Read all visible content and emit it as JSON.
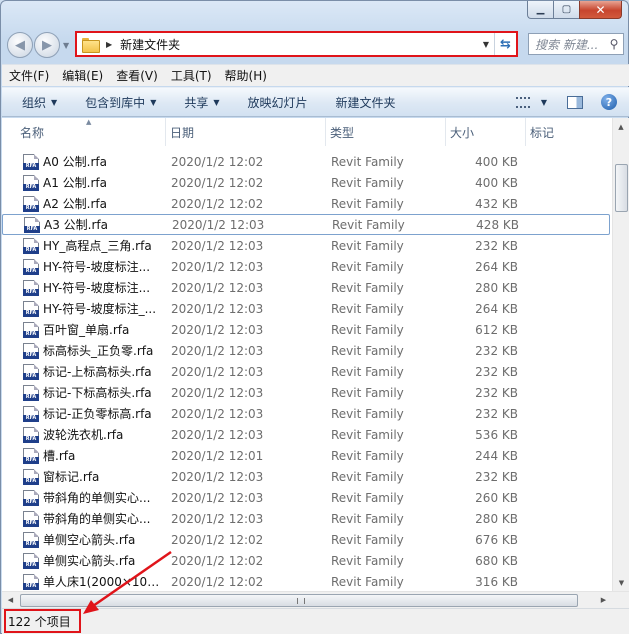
{
  "address": {
    "path": "新建文件夹"
  },
  "search": {
    "placeholder": "搜索 新建..."
  },
  "menu": [
    "文件(F)",
    "编辑(E)",
    "查看(V)",
    "工具(T)",
    "帮助(H)"
  ],
  "toolbar": {
    "organize": "组织",
    "include_library": "包含到库中",
    "share": "共享",
    "slideshow": "放映幻灯片",
    "new_folder": "新建文件夹"
  },
  "columns": {
    "name": "名称",
    "date": "日期",
    "type": "类型",
    "size": "大小",
    "tags": "标记"
  },
  "files": [
    {
      "name": "A0 公制.rfa",
      "date": "2020/1/2 12:02",
      "type": "Revit Family",
      "size": "400 KB"
    },
    {
      "name": "A1 公制.rfa",
      "date": "2020/1/2 12:02",
      "type": "Revit Family",
      "size": "400 KB"
    },
    {
      "name": "A2 公制.rfa",
      "date": "2020/1/2 12:02",
      "type": "Revit Family",
      "size": "432 KB"
    },
    {
      "name": "A3 公制.rfa",
      "date": "2020/1/2 12:03",
      "type": "Revit Family",
      "size": "428 KB",
      "selected": true
    },
    {
      "name": "HY_高程点_三角.rfa",
      "date": "2020/1/2 12:03",
      "type": "Revit Family",
      "size": "232 KB"
    },
    {
      "name": "HY-符号-坡度标注...",
      "date": "2020/1/2 12:03",
      "type": "Revit Family",
      "size": "264 KB"
    },
    {
      "name": "HY-符号-坡度标注...",
      "date": "2020/1/2 12:03",
      "type": "Revit Family",
      "size": "280 KB"
    },
    {
      "name": "HY-符号-坡度标注_...",
      "date": "2020/1/2 12:03",
      "type": "Revit Family",
      "size": "264 KB"
    },
    {
      "name": "百叶窗_单扇.rfa",
      "date": "2020/1/2 12:03",
      "type": "Revit Family",
      "size": "612 KB"
    },
    {
      "name": "标高标头_正负零.rfa",
      "date": "2020/1/2 12:03",
      "type": "Revit Family",
      "size": "232 KB"
    },
    {
      "name": "标记-上标高标头.rfa",
      "date": "2020/1/2 12:03",
      "type": "Revit Family",
      "size": "232 KB"
    },
    {
      "name": "标记-下标高标头.rfa",
      "date": "2020/1/2 12:03",
      "type": "Revit Family",
      "size": "232 KB"
    },
    {
      "name": "标记-正负零标高.rfa",
      "date": "2020/1/2 12:03",
      "type": "Revit Family",
      "size": "232 KB"
    },
    {
      "name": "波轮洗衣机.rfa",
      "date": "2020/1/2 12:03",
      "type": "Revit Family",
      "size": "536 KB"
    },
    {
      "name": "槽.rfa",
      "date": "2020/1/2 12:01",
      "type": "Revit Family",
      "size": "244 KB"
    },
    {
      "name": "窗标记.rfa",
      "date": "2020/1/2 12:03",
      "type": "Revit Family",
      "size": "232 KB"
    },
    {
      "name": "带斜角的单侧实心...",
      "date": "2020/1/2 12:03",
      "type": "Revit Family",
      "size": "260 KB"
    },
    {
      "name": "带斜角的单侧实心...",
      "date": "2020/1/2 12:03",
      "type": "Revit Family",
      "size": "280 KB"
    },
    {
      "name": "单侧空心箭头.rfa",
      "date": "2020/1/2 12:02",
      "type": "Revit Family",
      "size": "676 KB"
    },
    {
      "name": "单侧实心箭头.rfa",
      "date": "2020/1/2 12:02",
      "type": "Revit Family",
      "size": "680 KB"
    },
    {
      "name": "单人床1(2000×100...",
      "date": "2020/1/2 12:02",
      "type": "Revit Family",
      "size": "316 KB"
    }
  ],
  "status": {
    "count": "122 个项目"
  },
  "colors": {
    "highlight": "#e0141a",
    "toolbar_text": "#1e395b",
    "selection_border": "#7da2ce"
  }
}
